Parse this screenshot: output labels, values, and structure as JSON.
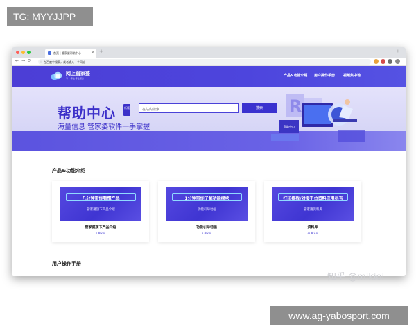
{
  "watermarks": {
    "top_left": "TG: MYYJJPP",
    "bottom_right": "www.ag-yabosport.com",
    "zhihu": "知乎 @mikioi"
  },
  "browser": {
    "tab_title": "首页 | 管家婆帮助中心",
    "address": "在百度中搜索，或者输入一个网址",
    "new_tab": "+",
    "close_tab": "×",
    "menu": "⋮",
    "nav": {
      "back": "←",
      "forward": "→",
      "reload": "⟳",
      "home": "⌂"
    },
    "lock": "ⓘ"
  },
  "header": {
    "logo_main": "网上管家婆",
    "logo_sub": "专一·专注·专业服务",
    "nav": [
      "产品&功能介绍",
      "用户操作手册",
      "视频集中地"
    ]
  },
  "hero": {
    "title": "帮助中心",
    "badge": "新版",
    "subtitle": "海量信息  管家婆软件一手掌握",
    "search_placeholder": "在站内搜索",
    "search_button": "搜索",
    "illustration_label": "帮助中心"
  },
  "sections": {
    "products_title": "产品&功能介绍",
    "manual_title": "用户操作手册"
  },
  "cards": [
    {
      "banner_head": "几分钟带你看懂产品",
      "banner_caption": "管家婆旗下产品介绍",
      "title": "管家婆旗下产品介绍",
      "count": "2 篇文章"
    },
    {
      "banner_head": "1分钟带你了解功能模块",
      "banner_caption": "功能引导动画",
      "title": "功能引导动画",
      "count": "1 篇文章"
    },
    {
      "banner_head": "打印模板/对接平台资料应用尽有",
      "banner_caption": "管家婆资料库",
      "title": "资料库",
      "count": "11 篇文章"
    }
  ],
  "colors": {
    "brand": "#4c3ed6",
    "hero_text": "#3c30c9",
    "search_button": "#3a31cf"
  }
}
